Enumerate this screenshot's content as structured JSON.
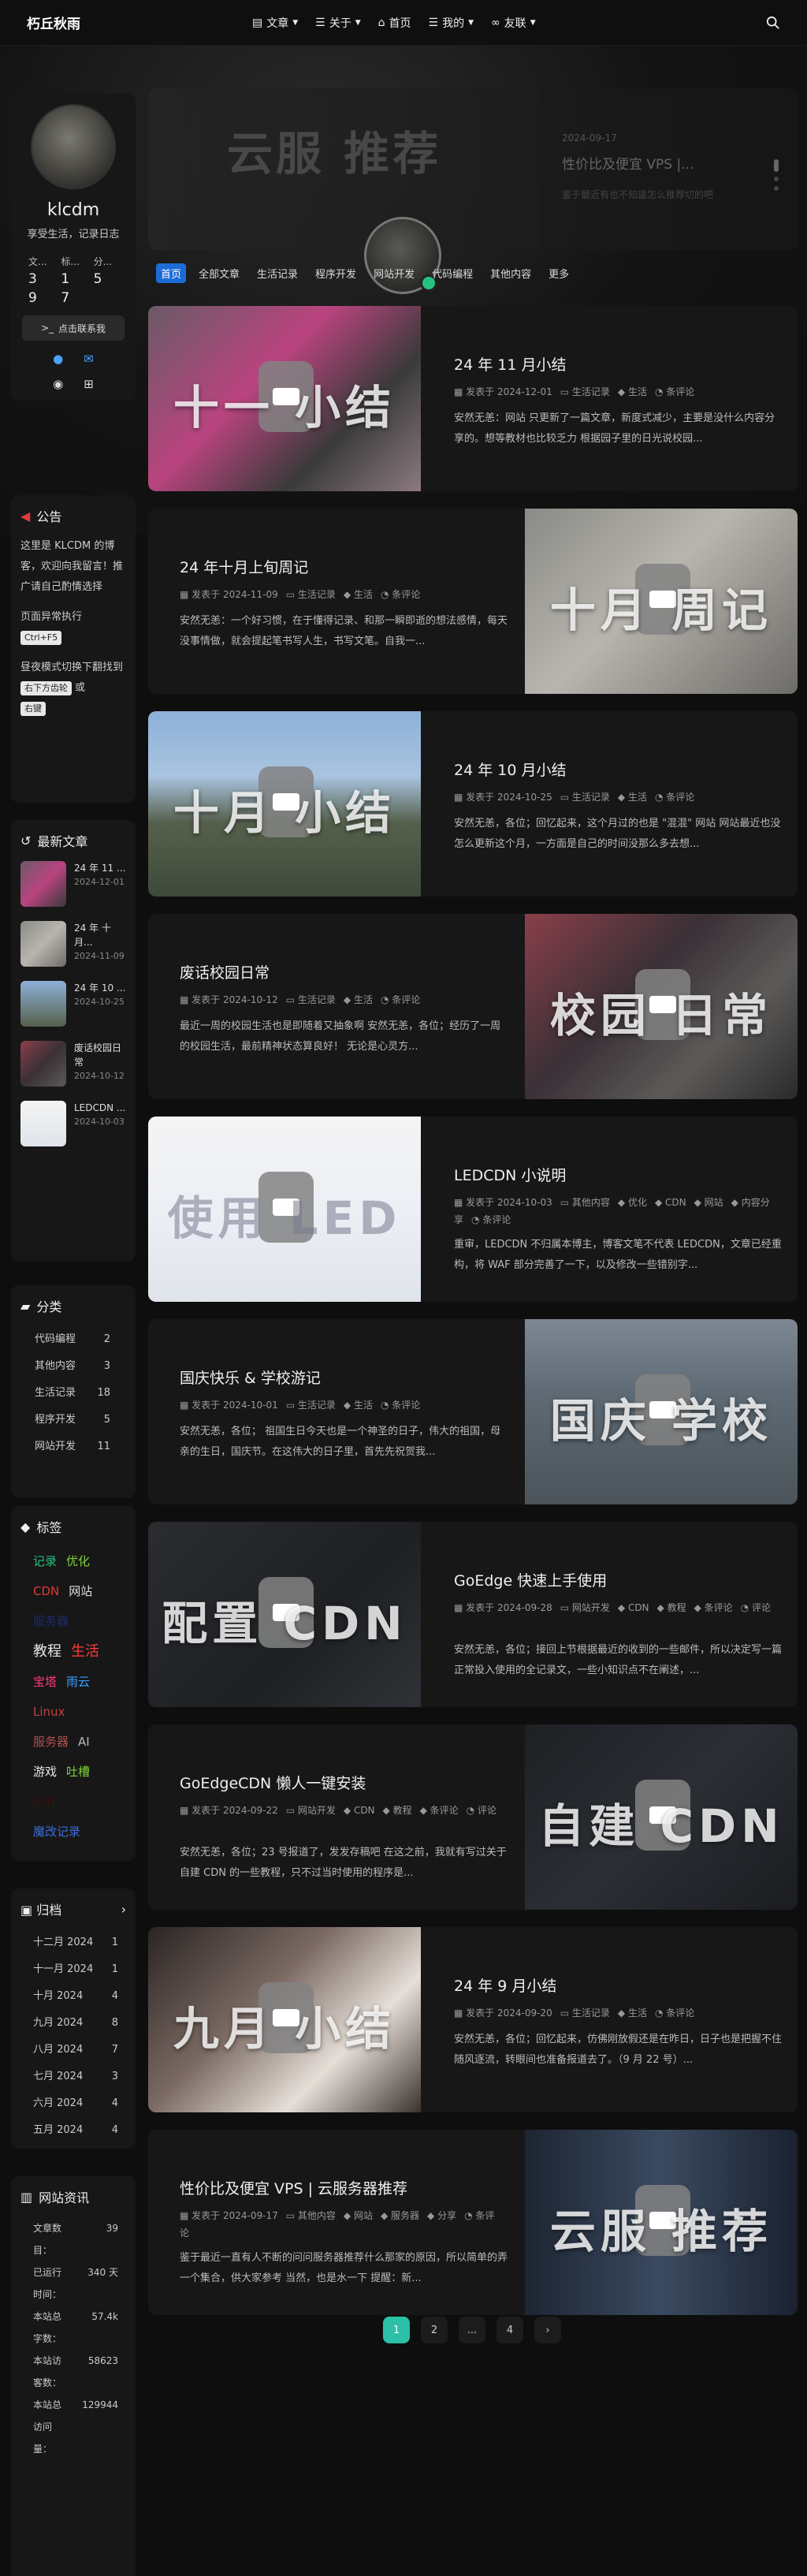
{
  "site": {
    "brand": "朽丘秋雨"
  },
  "nav": {
    "items": [
      {
        "label": "文章",
        "icon": "book-icon",
        "dropdown": true
      },
      {
        "label": "关于",
        "icon": "list-icon",
        "dropdown": true
      },
      {
        "label": "首页",
        "icon": "home-icon",
        "dropdown": false
      },
      {
        "label": "我的",
        "icon": "list-icon",
        "dropdown": true
      },
      {
        "label": "友联",
        "icon": "link-icon",
        "dropdown": true
      }
    ]
  },
  "profile": {
    "name": "klcdm",
    "desc": "享受生活，记录日志",
    "stats": [
      {
        "label": "文...",
        "value": "3"
      },
      {
        "label": "标...",
        "value": "1"
      },
      {
        "label": "分...",
        "value": "5"
      }
    ],
    "stats2": [
      "9",
      "7"
    ],
    "contact": "点击联系我"
  },
  "notice": {
    "title": "公告",
    "text": "这里是 KLCDM 的博客，欢迎向我留言！推广请自己酌情选择",
    "line2": "页面异常执行",
    "kbd1": "Ctrl+F5",
    "line3": "昼夜模式切换下翻找到",
    "kbd2": "右下方齿轮",
    "or": "或",
    "kbd3": "右键"
  },
  "recent": {
    "title": "最新文章",
    "items": [
      {
        "title": "24 年 11 ...",
        "date": "2024-12-01"
      },
      {
        "title": "24 年 十月...",
        "date": "2024-11-09"
      },
      {
        "title": "24 年 10 ...",
        "date": "2024-10-25"
      },
      {
        "title": "废话校园日常",
        "date": "2024-10-12"
      },
      {
        "title": "LEDCDN ...",
        "date": "2024-10-03"
      }
    ]
  },
  "categories": {
    "title": "分类",
    "items": [
      {
        "name": "代码编程",
        "count": "2"
      },
      {
        "name": "其他内容",
        "count": "3"
      },
      {
        "name": "生活记录",
        "count": "18"
      },
      {
        "name": "程序开发",
        "count": "5"
      },
      {
        "name": "网站开发",
        "count": "11"
      }
    ]
  },
  "tags": {
    "title": "标签",
    "lines": [
      [
        {
          "t": "记录",
          "c": "#26c281"
        },
        {
          "t": "优化",
          "c": "#7fd13b"
        }
      ],
      [
        {
          "t": "CDN",
          "c": "#e03a3a"
        },
        {
          "t": "网站",
          "c": "#dddddd"
        }
      ],
      [
        {
          "t": "服务器",
          "c": "#1e2a6e"
        }
      ],
      [
        {
          "t": "教程",
          "c": "#e8e8e8"
        },
        {
          "t": "生活",
          "c": "#ff3b3b"
        }
      ],
      [
        {
          "t": "宝塔",
          "c": "#ff3b7a"
        },
        {
          "t": "雨云",
          "c": "#3aa0ff"
        }
      ],
      [
        {
          "t": "Linux",
          "c": "#c04040"
        }
      ],
      [
        {
          "t": "服务器",
          "c": "#b05050"
        },
        {
          "t": "AI",
          "c": "#bbbbbb"
        }
      ],
      [
        {
          "t": "游戏",
          "c": "#e8e8e8"
        },
        {
          "t": "吐槽",
          "c": "#7fd13b"
        }
      ],
      [
        {
          "t": "Ssh",
          "c": "#3a1010"
        }
      ],
      [
        {
          "t": "魔改记录",
          "c": "#3a6ee0"
        }
      ]
    ]
  },
  "archive": {
    "title": "归档",
    "items": [
      {
        "month": "十二月 2024",
        "count": "1"
      },
      {
        "month": "十一月 2024",
        "count": "1"
      },
      {
        "month": "十月 2024",
        "count": "4"
      },
      {
        "month": "九月 2024",
        "count": "8"
      },
      {
        "month": "八月 2024",
        "count": "7"
      },
      {
        "month": "七月 2024",
        "count": "3"
      },
      {
        "month": "六月 2024",
        "count": "4"
      },
      {
        "month": "五月 2024",
        "count": "4"
      }
    ]
  },
  "site_info": {
    "title": "网站资讯",
    "rows": [
      {
        "k": "文章数目：",
        "v": "39"
      },
      {
        "k": "已运行时间：",
        "v": "340 天"
      },
      {
        "k": "本站总字数：",
        "v": "57.4k"
      },
      {
        "k": "本站访客数：",
        "v": "58623"
      },
      {
        "k": "本站总访问量：",
        "v": "129944"
      }
    ]
  },
  "featured": {
    "image_text": "云服 推荐",
    "date": "2024-09-17",
    "title": "性价比及便宜 VPS |...",
    "excerpt": "鉴于最近有也不知道怎么推荐切的吧"
  },
  "tabs": [
    "首页",
    "全部文章",
    "生活记录",
    "程序开发",
    "网站开发",
    "代码编程",
    "其他内容",
    "更多"
  ],
  "posts": [
    {
      "side": "left",
      "title": "24 年 11 月小结",
      "image_text": "十一 小结",
      "date": "发表于 2024-12-01",
      "cat": "生活记录",
      "tag": "生活",
      "comment": "条评论",
      "excerpt": "安然无恙：网站 只更新了一篇文章，新度式减少，主要是没什么内容分享的。想等教材也比较乏力 根据园子里的日光说校园...",
      "bg": "linear-gradient(135deg,#6a5a66 0%,#b9447f 40%,#3a3a3a 70%,#8c7a80 100%)"
    },
    {
      "side": "right",
      "title": "24 年十月上旬周记",
      "image_text": "十月 周记",
      "date": "发表于 2024-11-09",
      "cat": "生活记录",
      "tag": "生活",
      "comment": "条评论",
      "excerpt": "安然无恙：一个好习惯，在于懂得记录、和那一瞬即逝的想法感情，每天没事情做，就会提起笔书写人生，书写文笔。自我一...",
      "bg": "linear-gradient(135deg,#8a8a86 0%,#b8b5ae 45%,#6e6c68 100%)"
    },
    {
      "side": "left",
      "title": "24 年 10 月小结",
      "image_text": "十月 小结",
      "date": "发表于 2024-10-25",
      "cat": "生活记录",
      "tag": "生活",
      "comment": "条评论",
      "excerpt": "安然无恙，各位；回忆起来，这个月过的也是 \"混混\" 网站 网站最近也没怎么更新这个月，一方面是自己的时间没那么多去想...",
      "bg": "linear-gradient(180deg,#8db0d8 0%,#a9c4e0 35%,#55604c 60%,#3e4a3a 100%)"
    },
    {
      "side": "right",
      "title": "废话校园日常",
      "image_text": "校园 日常",
      "date": "发表于 2024-10-12",
      "cat": "生活记录",
      "tag": "生活",
      "comment": "条评论",
      "excerpt": "最近一周的校园生活也是即随着又抽象啊 安然无恙，各位；经历了一周的校园生活，最前精神状态算良好！ 无论是心灵方...",
      "bg": "linear-gradient(135deg,#8a3f4a 0%,#3a3036 40%,#5c5a58 70%,#2a2a2a 100%)"
    },
    {
      "side": "left",
      "title": "LEDCDN 小说明",
      "image_text": "使用 LED",
      "date": "发表于 2024-10-03",
      "cat": "其他内容",
      "tag": "优化",
      "tag2": "CDN",
      "tag3": "网站",
      "tag4": "内容分享",
      "comment": "条评论",
      "excerpt": "重审，LEDCDN 不归属本博主，博客文笔不代表 LEDCDN，文章已经重构，将 WAF 部分完善了一下，以及修改一些错别字...",
      "bg": "linear-gradient(180deg,#f4f4f4 0%,#eaeef4 60%,#dfe4ea 100%)",
      "dark": true
    },
    {
      "side": "right",
      "title": "国庆快乐 & 学校游记",
      "image_text": "国庆 学校",
      "date": "发表于 2024-10-01",
      "cat": "生活记录",
      "tag": "生活",
      "comment": "条评论",
      "excerpt": "安然无恙，各位； 祖国生日今天也是一个神圣的日子，伟大的祖国，母亲的生日，国庆节。在这伟大的日子里，首先先祝贺我...",
      "bg": "linear-gradient(180deg,#7d8894 0%,#5e6a74 40%,#4b545a 100%)"
    },
    {
      "side": "left",
      "title": "GoEdge 快速上手使用",
      "image_text": "配置 CDN",
      "date": "发表于 2024-09-28",
      "cat": "网站开发",
      "tag": "CDN",
      "tag2": "教程",
      "tag3": "条评论",
      "comment": "评论",
      "excerpt": "安然无恙，各位；接回上节根据最近的收到的一些邮件，所以决定写一篇正常投入使用的全记录文，一些小知识点不在阐述，...",
      "bg": "linear-gradient(135deg,#2a2c30 0%,#1e2024 60%,#2f3236 100%)"
    },
    {
      "side": "right",
      "title": "GoEdgeCDN 懒人一键安装",
      "image_text": "自建 CDN",
      "date": "发表于 2024-09-22",
      "cat": "网站开发",
      "tag": "CDN",
      "tag2": "教程",
      "tag3": "条评论",
      "comment": "评论",
      "excerpt": "安然无恙，各位；23 号报道了，发发存稿吧 在这之前，我就有写过关于自建 CDN 的一些教程，只不过当时使用的程序是...",
      "bg": "linear-gradient(135deg,#1e2024 0%,#2b2e34 50%,#1a1c20 100%)"
    },
    {
      "side": "left",
      "title": "24 年 9 月小结",
      "image_text": "九月 小结",
      "date": "发表于 2024-09-20",
      "cat": "生活记录",
      "tag": "生活",
      "comment": "条评论",
      "excerpt": "安然无恙，各位；回忆起来，仿佛刚放假还是在昨日，日子也是把握不住随风逐流，转眼间也准备报道去了。（9 月 22 号）...",
      "bg": "linear-gradient(135deg,#2a2423 0%,#7b6a63 40%,#e6dfd8 70%,#3b3230 100%)"
    },
    {
      "side": "right",
      "title": "性价比及便宜 VPS | 云服务器推荐",
      "image_text": "云服 推荐",
      "date": "发表于 2024-09-17",
      "cat": "其他内容",
      "tag": "网站",
      "tag2": "服务器",
      "tag3": "分享",
      "comment": "条评论",
      "excerpt": "鉴于最近一直有人不断的问问服务器推荐什么那家的原因，所以简单的弄一个集合，供大家参考 当然，也是水一下 提醒：新...",
      "bg": "linear-gradient(90deg,#1d2532 0%,#3b4a60 50%,#1a2230 100%)"
    }
  ],
  "pager": [
    "1",
    "2",
    "...",
    "4",
    "›"
  ]
}
